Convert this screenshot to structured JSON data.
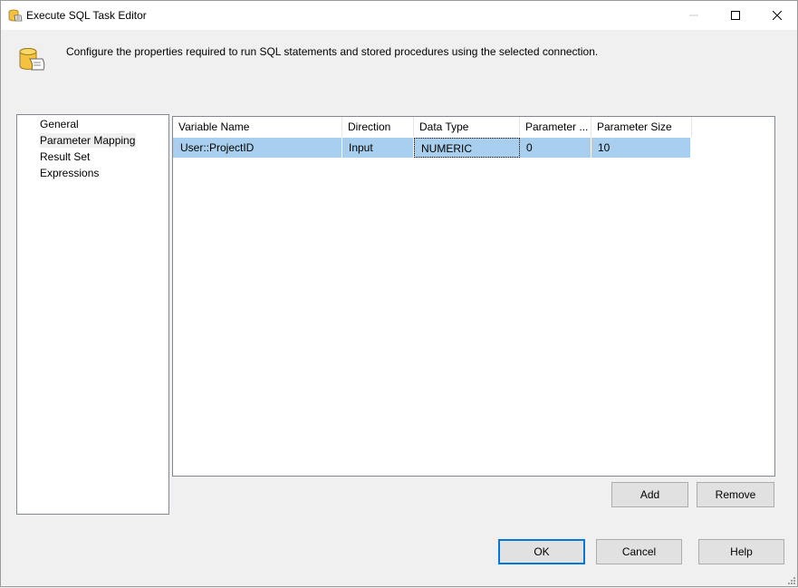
{
  "window": {
    "title": "Execute SQL Task Editor",
    "icon": "sql-task-icon"
  },
  "header": {
    "description": "Configure the properties required to run SQL statements and stored procedures using the selected connection.",
    "icon": "database-script-icon"
  },
  "nav": {
    "items": [
      {
        "label": "General",
        "selected": false
      },
      {
        "label": "Parameter Mapping",
        "selected": true
      },
      {
        "label": "Result Set",
        "selected": false
      },
      {
        "label": "Expressions",
        "selected": false
      }
    ]
  },
  "grid": {
    "columns": [
      "Variable Name",
      "Direction",
      "Data Type",
      "Parameter ...",
      "Parameter Size"
    ],
    "rows": [
      [
        "User::ProjectID",
        "Input",
        "NUMERIC",
        "0",
        "10"
      ]
    ],
    "selected_row": 0
  },
  "buttons": {
    "add": "Add",
    "remove": "Remove",
    "ok": "OK",
    "cancel": "Cancel",
    "help": "Help"
  },
  "colors": {
    "selection": "#a8cfee",
    "accent": "#0078d7"
  }
}
